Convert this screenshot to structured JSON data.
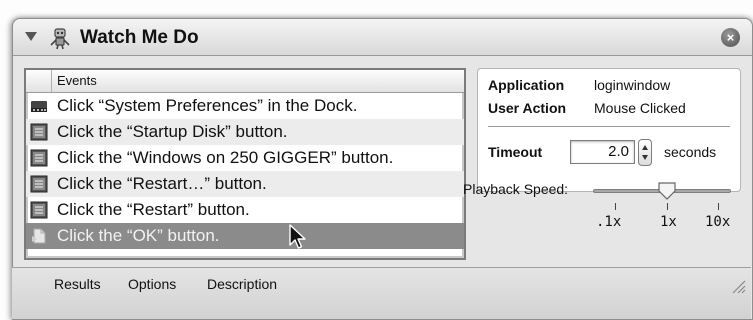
{
  "action": {
    "title": "Watch Me Do",
    "close_label": "×",
    "icon": "robot-icon"
  },
  "events": {
    "column_header": "Events",
    "rows": [
      {
        "text": "Click “System Preferences” in the Dock.",
        "icon": "dock-icon"
      },
      {
        "text": "Click the “Startup Disk” button.",
        "icon": "button-icon"
      },
      {
        "text": "Click the “Windows on 250 GIGGER” button.",
        "icon": "button-icon"
      },
      {
        "text": "Click the “Restart…” button.",
        "icon": "button-icon"
      },
      {
        "text": "Click the “Restart” button.",
        "icon": "button-icon"
      },
      {
        "text": "Click the “OK” button.",
        "icon": "document-icon",
        "selected": true
      }
    ]
  },
  "details": {
    "application_label": "Application",
    "application_value": "loginwindow",
    "user_action_label": "User Action",
    "user_action_value": "Mouse Clicked",
    "timeout_label": "Timeout",
    "timeout_value": "2.0",
    "timeout_unit": "seconds"
  },
  "playback": {
    "label": "Playback Speed:",
    "ticks": [
      ".1x",
      "1x",
      "10x"
    ],
    "value": "1x"
  },
  "bottom_tabs": [
    "Results",
    "Options",
    "Description"
  ],
  "colors": {
    "selection": "#8b8b8b",
    "panel": "#e6e6e6"
  }
}
